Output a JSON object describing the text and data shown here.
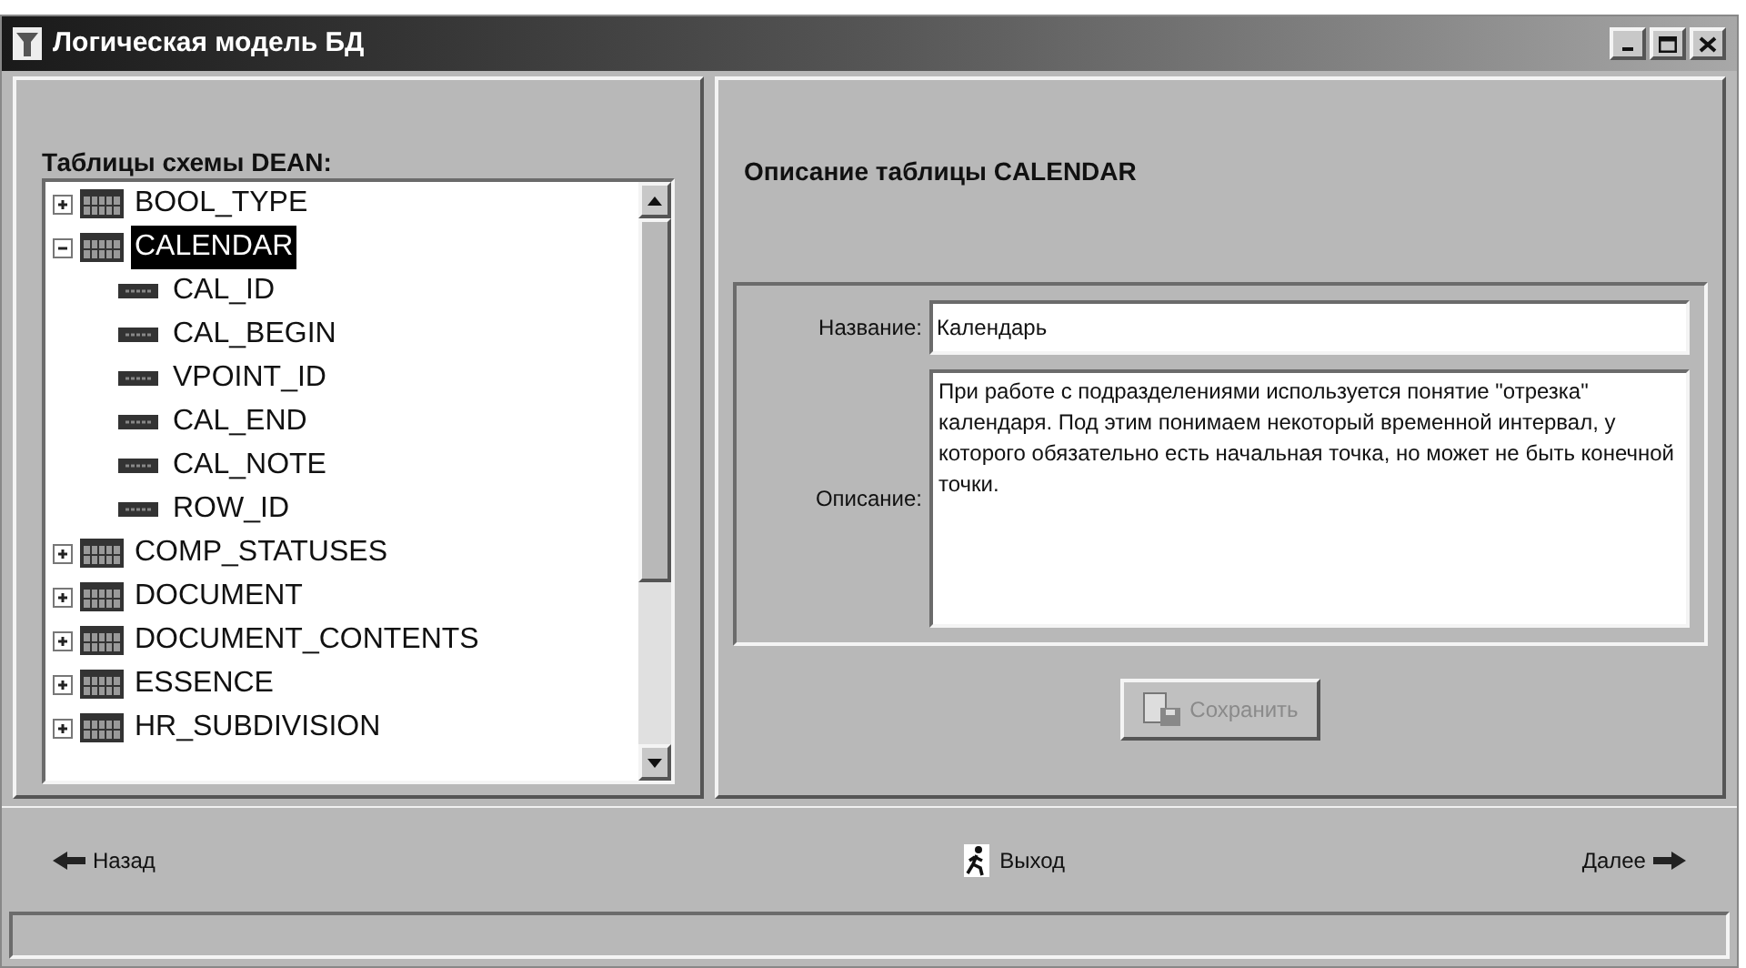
{
  "window": {
    "title": "Логическая модель БД"
  },
  "tree": {
    "label": "Таблицы схемы DEAN:",
    "items": [
      {
        "label": "BOOL_TYPE",
        "expanded": false,
        "selected": false
      },
      {
        "label": "CALENDAR",
        "expanded": true,
        "selected": true,
        "children": [
          {
            "label": "CAL_ID",
            "selected": false
          },
          {
            "label": "CAL_BEGIN",
            "selected": false
          },
          {
            "label": "VPOINT_ID",
            "selected": false
          },
          {
            "label": "CAL_END",
            "selected": false
          },
          {
            "label": "CAL_NOTE",
            "selected": false
          },
          {
            "label": "ROW_ID",
            "selected": false
          }
        ]
      },
      {
        "label": "COMP_STATUSES",
        "expanded": false,
        "selected": false
      },
      {
        "label": "DOCUMENT",
        "expanded": false,
        "selected": false
      },
      {
        "label": "DOCUMENT_CONTENTS",
        "expanded": false,
        "selected": false
      },
      {
        "label": "ESSENCE",
        "expanded": false,
        "selected": false
      },
      {
        "label": "HR_SUBDIVISION",
        "expanded": false,
        "selected": false
      }
    ]
  },
  "details": {
    "heading": "Описание таблицы CALENDAR",
    "name_label": "Название:",
    "name_value": "Календарь",
    "description_label": "Описание:",
    "description_value": "При работе с подразделениями используется понятие \"отрезка\" календаря. Под этим понимаем некоторый временной интервал, у которого обязательно есть начальная точка, но может не быть конечной точки.",
    "save_button": {
      "label": "Сохранить",
      "disabled": true
    }
  },
  "nav": {
    "back": "Назад",
    "exit": "Выход",
    "next": "Далее"
  }
}
